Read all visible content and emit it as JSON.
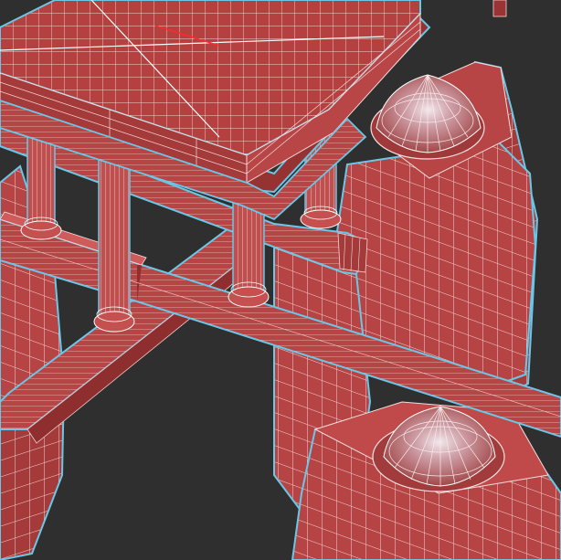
{
  "viewport": {
    "background_color": "#2f2f2f",
    "render_mode": "wireframe-on-shaded",
    "mesh_color": "#c44a4a",
    "mesh_dark_color": "#8f2a2a",
    "edge_color": "#ffffff",
    "selection_outline_color": "#69c8e8"
  }
}
